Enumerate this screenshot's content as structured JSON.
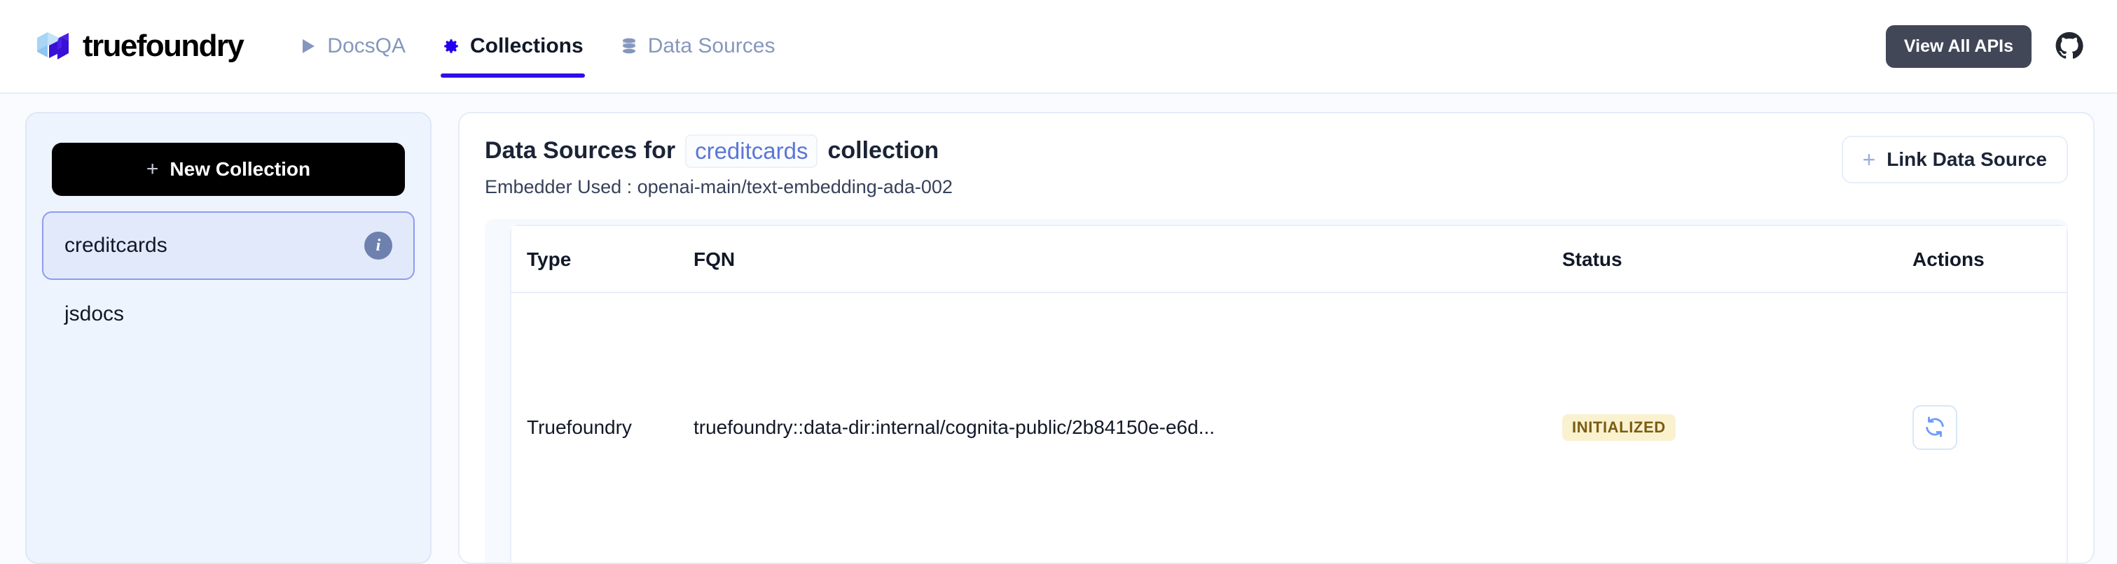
{
  "brand": {
    "name": "truefoundry",
    "logo_icon": "truefoundry-cube-logo"
  },
  "nav": {
    "tabs": [
      {
        "label": "DocsQA",
        "icon": "play-triangle-icon",
        "active": false
      },
      {
        "label": "Collections",
        "icon": "gear-icon",
        "active": true
      },
      {
        "label": "Data Sources",
        "icon": "database-icon",
        "active": false
      }
    ],
    "view_all_apis_label": "View All APIs",
    "github_icon": "github-icon"
  },
  "sidebar": {
    "new_collection_label": "New Collection",
    "new_collection_plus": "+",
    "items": [
      {
        "label": "creditcards",
        "selected": true,
        "info_icon": "info-icon",
        "info_glyph": "i"
      },
      {
        "label": "jsdocs",
        "selected": false
      }
    ]
  },
  "main": {
    "title_prefix": "Data Sources for",
    "collection_name": "creditcards",
    "title_suffix": "collection",
    "embedder_line": "Embedder Used : openai-main/text-embedding-ada-002",
    "link_data_source_label": "Link Data Source",
    "link_data_source_plus": "+"
  },
  "table": {
    "columns": [
      "Type",
      "FQN",
      "Status",
      "Actions"
    ],
    "rows": [
      {
        "type": "Truefoundry",
        "fqn": "truefoundry::data-dir:internal/cognita-public/2b84150e-e6d...",
        "status": "INITIALIZED",
        "action_icon": "refresh-sync-icon"
      }
    ]
  },
  "colors": {
    "accent_blue": "#2D0FEA",
    "nav_inactive": "#8697BE",
    "page_bg": "#F9FBFE",
    "sidebar_bg": "#EEF4FD",
    "selected_item_bg": "#E2E9FA",
    "selected_item_border": "#8E9BF0",
    "status_badge_bg": "#FAF1CF",
    "status_badge_text": "#7A5C11",
    "dark_button": "#414756",
    "action_icon_blue": "#6B9BF7"
  }
}
